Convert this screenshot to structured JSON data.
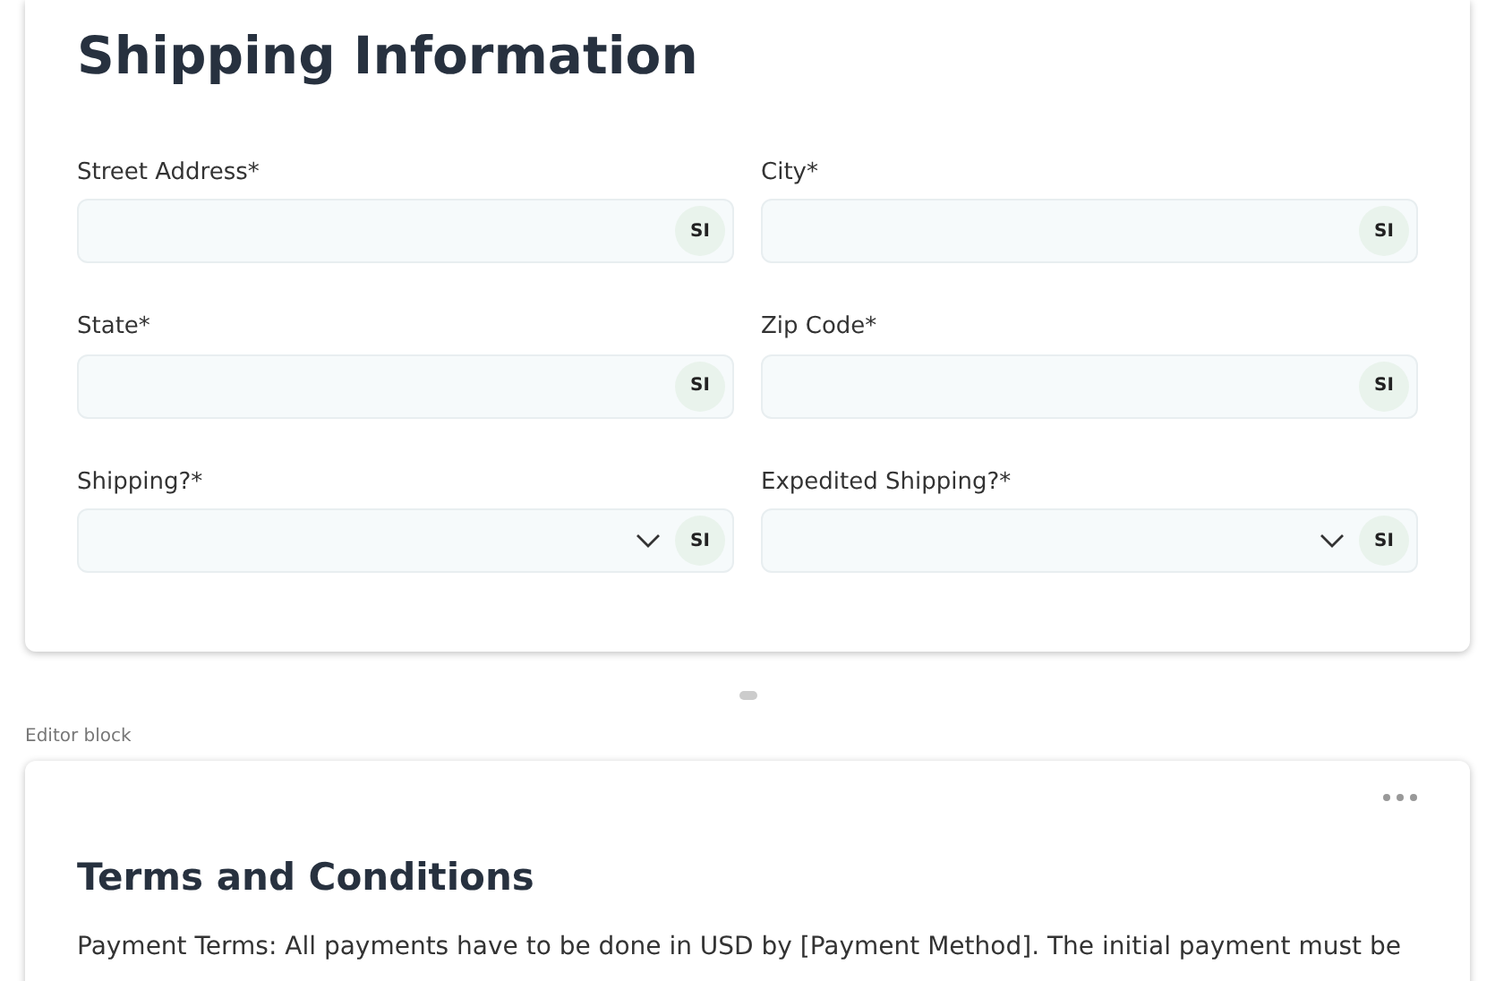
{
  "shipping_form": {
    "title": "Shipping Information",
    "fields": [
      {
        "label": "Street Address*",
        "kind": "text",
        "badge": "SI"
      },
      {
        "label": "City*",
        "kind": "text",
        "badge": "SI"
      },
      {
        "label": "State*",
        "kind": "text",
        "badge": "SI"
      },
      {
        "label": "Zip Code*",
        "kind": "text",
        "badge": "SI"
      },
      {
        "label": "Shipping?*",
        "kind": "select",
        "badge": "SI"
      },
      {
        "label": "Expedited Shipping?*",
        "kind": "select",
        "badge": "SI"
      }
    ]
  },
  "block_caption": "Editor block",
  "editor_block": {
    "heading": "Terms and Conditions",
    "paragraph": "Payment Terms: All payments have to be done in USD by [Payment Method]. The initial payment must be"
  }
}
